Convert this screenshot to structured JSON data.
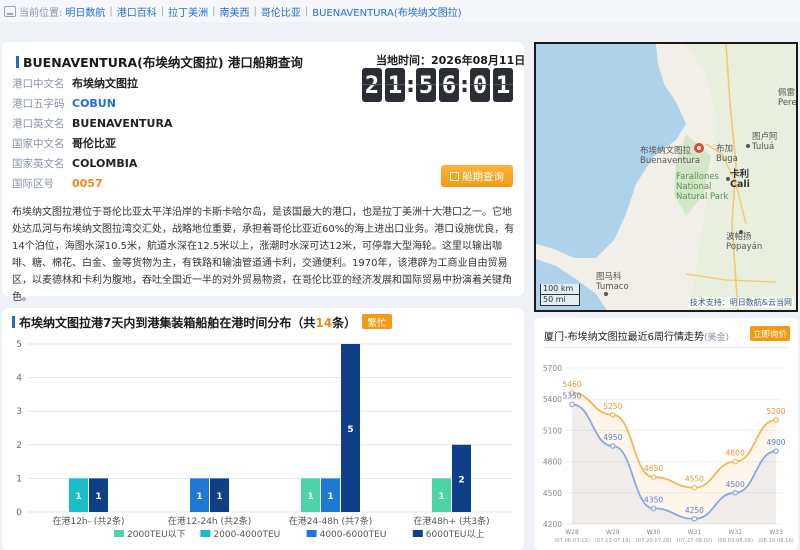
{
  "breadcrumb": {
    "prefix": "当前位置:",
    "items": [
      "明日数航",
      "港口百科",
      "拉丁美洲",
      "南美西",
      "哥伦比亚",
      "BUENAVENTURA(布埃纳文图拉)"
    ]
  },
  "port": {
    "title": "BUENAVENTURA(布埃纳文图拉) 港口船期查询",
    "time_label": "当地时间：2026年08月11日",
    "clock_digits": [
      "2",
      "1",
      "5",
      "6",
      "0",
      "1"
    ],
    "fields": [
      {
        "key": "港口中文名",
        "value": "布埃纳文图拉",
        "style": ""
      },
      {
        "key": "港口五字码",
        "value": "COBUN",
        "style": "blue"
      },
      {
        "key": "港口英文名",
        "value": "BUENAVENTURA",
        "style": ""
      },
      {
        "key": "国家中文名",
        "value": "哥伦比亚",
        "style": ""
      },
      {
        "key": "国家英文名",
        "value": "COLOMBIA",
        "style": ""
      },
      {
        "key": "国际区号",
        "value": "0057",
        "style": "orange"
      }
    ],
    "query_button": "船期查询",
    "description": "布埃纳文图拉港位于哥伦比亚太平洋沿岸的卡斯卡哈尔岛，是该国最大的港口，也是拉丁美洲十大港口之一。它地处达瓜河与布埃纳文图拉湾交汇处，战略地位重要，承担着哥伦比亚近60%的海上进出口业务。港口设施优良，有14个泊位，海图水深10.5米，航道水深在12.5米以上，涨潮时水深可达12米，可停靠大型海轮。这里以输出咖啡、糖、棉花、白金、金等货物为主，有铁路和输油管道通卡利，交通便利。1970年，该港辟为工商业自由贸易区，以麦德林和卡利为腹地，吞吐全国近一半的对外贸易物资，在哥伦比亚的经济发展和国际贸易中扮演着关键角色。"
  },
  "map": {
    "labels": [
      {
        "text": "布埃纳文图拉\nBuenaventura",
        "cls": "port"
      },
      {
        "text": "图卢阿\nTuluá",
        "cls": "tulua"
      },
      {
        "text": "布加\nBuga",
        "cls": "buga"
      },
      {
        "text": "卡利\nCali",
        "cls": "cali"
      },
      {
        "text": "Farallones\nNational\nNatural Park",
        "cls": "park"
      },
      {
        "text": "波帕扬\nPopayán",
        "cls": "popayan"
      },
      {
        "text": "图马科\nTumaco",
        "cls": "tumaco"
      },
      {
        "text": "佩雷\nPere",
        "cls": "pere"
      }
    ],
    "scale_km": "100 km",
    "scale_mi": "50 mi",
    "credit": "技术支持：明日数航&云当网"
  },
  "bar_chart": {
    "title_prefix": "布埃纳文图拉港7天内到港集装箱船舶在港时间分布（共",
    "total": "14",
    "title_suffix": "条）",
    "badge": "繁忙"
  },
  "trend": {
    "title": "厦门-布埃纳文图拉最近6周行情走势",
    "unit": "(美金)",
    "button": "立即询价"
  },
  "chart_data": [
    {
      "type": "bar",
      "title": "布埃纳文图拉港7天内到港集装箱船舶在港时间分布（共14条）",
      "categories": [
        "在港12h- (共2条)",
        "在港12-24h (共2条)",
        "在港24-48h (共7条)",
        "在港48h+ (共3条)"
      ],
      "series": [
        {
          "name": "2000TEU以下",
          "color": "#4cd4a8",
          "values": [
            0,
            0,
            1,
            1
          ]
        },
        {
          "name": "2000-4000TEU",
          "color": "#1bbcc9",
          "values": [
            1,
            0,
            0,
            0
          ]
        },
        {
          "name": "4000-6000TEU",
          "color": "#1f78d1",
          "values": [
            0,
            1,
            1,
            0
          ]
        },
        {
          "name": "6000TEU以上",
          "color": "#0f3f86",
          "values": [
            1,
            1,
            5,
            2
          ]
        }
      ],
      "ylim": [
        0,
        5
      ],
      "yticks": [
        0,
        1,
        2,
        3,
        4,
        5
      ],
      "grid": true,
      "legend": "bottom"
    },
    {
      "type": "line",
      "title": "厦门-布埃纳文图拉最近6周行情走势",
      "x": [
        "W28\n(07.06-07.12)",
        "W29\n(07.13-07.19)",
        "W30\n(07.20-07.26)",
        "W31\n(07.27-08.02)",
        "W32\n(08.03-08.09)",
        "W33\n(08.10-08.16)"
      ],
      "series": [
        {
          "color": "#f5b556",
          "values": [
            5460,
            5250,
            4650,
            4550,
            4800,
            5200
          ]
        },
        {
          "color": "#8aa6e8",
          "values": [
            5350,
            4950,
            4350,
            4250,
            4500,
            4900
          ]
        }
      ],
      "ylim": [
        4200,
        5700
      ],
      "yticks": [
        4200,
        4500,
        4800,
        5100,
        5400,
        5700
      ],
      "grid": true
    }
  ]
}
